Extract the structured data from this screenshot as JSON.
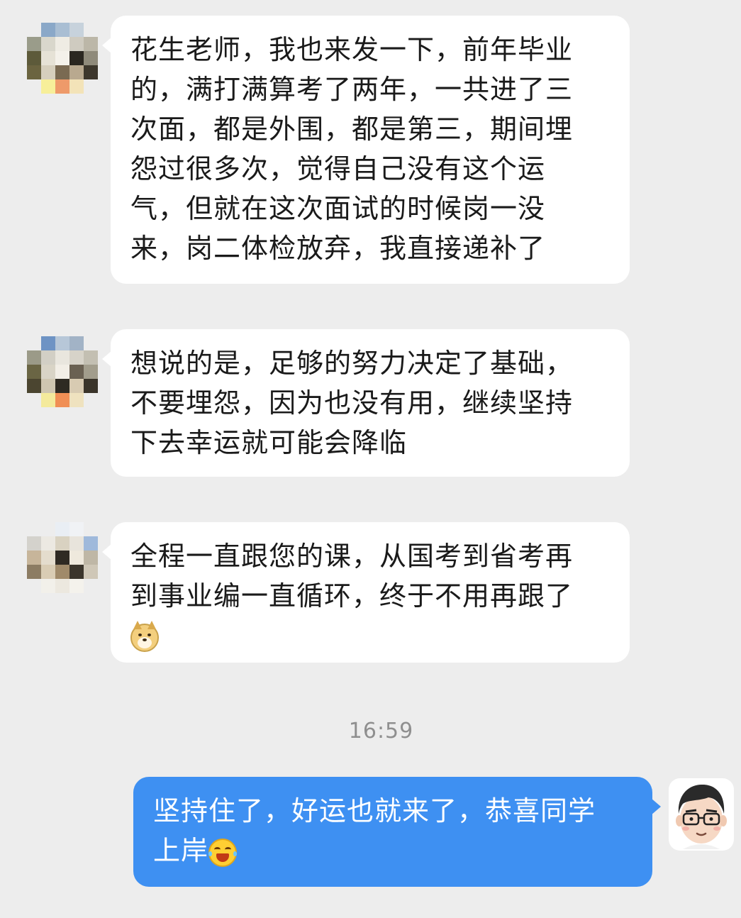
{
  "messages": [
    {
      "sender": "other",
      "lines": [
        "花生老师，我也来发一下，前年毕业",
        "的，满打满算考了两年，一共进了三",
        "次面，都是外围，都是第三，期间埋",
        "怨过很多次，觉得自己没有这个运",
        "气，但就在这次面试的时候岗一没",
        "来，岗二体检放弃，我直接递补了"
      ]
    },
    {
      "sender": "other",
      "lines": [
        "想说的是，足够的努力决定了基础，",
        "不要埋怨，因为也没有用，继续坚持",
        "下去幸运就可能会降临"
      ]
    },
    {
      "sender": "other",
      "lines": [
        "全程一直跟您的课，从国考到省考再",
        "到事业编一直循环，终于不用再跟了"
      ],
      "trailing_emoji": "doge-emoji"
    }
  ],
  "timestamp": "16:59",
  "reply": {
    "sender": "self",
    "lines": [
      "坚持住了，好运也就来了，恭喜同学",
      "上岸"
    ],
    "trailing_emoji": "laughing-tears-emoji"
  },
  "colors": {
    "background": "#ededed",
    "incoming_bubble": "#ffffff",
    "outgoing_bubble": "#3e90f2",
    "timestamp_text": "#8f8f8f"
  }
}
